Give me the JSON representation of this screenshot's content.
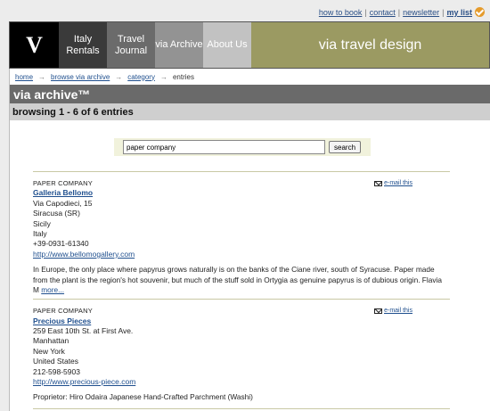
{
  "top_links": {
    "how_to_book": "how to book",
    "contact": "contact",
    "newsletter": "newsletter",
    "my_list": "my list",
    "sep": "|"
  },
  "header": {
    "logo": "V",
    "nav": [
      {
        "label": "Italy Rentals"
      },
      {
        "label": "Travel Journal"
      },
      {
        "label": "via Archive"
      },
      {
        "label": "About Us"
      }
    ],
    "brand": "via travel design"
  },
  "breadcrumb": {
    "items": [
      "home",
      "browse via archive",
      "category",
      "entries"
    ],
    "arrow": "→"
  },
  "page": {
    "title": "via archive™",
    "browsing": "browsing 1 - 6 of 6 entries"
  },
  "search": {
    "value": "paper company",
    "button": "search"
  },
  "entries": [
    {
      "category": "PAPER COMPANY",
      "name": "Galleria Bellomo",
      "email_label": "e-mail this",
      "address": [
        "Via Capodieci, 15",
        "Siracusa (SR)",
        "Sicily",
        "Italy",
        "+39-0931-61340"
      ],
      "url": "http://www.bellomogallery.com",
      "description": "In Europe, the only place where papyrus grows naturally is on the banks of the Ciane river, south of Syracuse. Paper made from the plant is the region's hot souvenir, but much of the stuff sold in Ortygia as genuine papyrus is of dubious origin. Flavia M",
      "more": "more..."
    },
    {
      "category": "PAPER COMPANY",
      "name": "Precious Pieces",
      "email_label": "e-mail this",
      "address": [
        "259 East 10th St. at First Ave.",
        "Manhattan",
        "New York",
        "United States",
        "212-598-5903"
      ],
      "url": "http://www.precious-piece.com",
      "description": "Proprietor: Hiro Odaira Japanese Hand-Crafted Parchment (Washi)",
      "more": ""
    }
  ],
  "colors": {
    "brand_olive": "#9b9a62",
    "link_blue": "#1f4f8e",
    "check_orange": "#e59b2c"
  }
}
